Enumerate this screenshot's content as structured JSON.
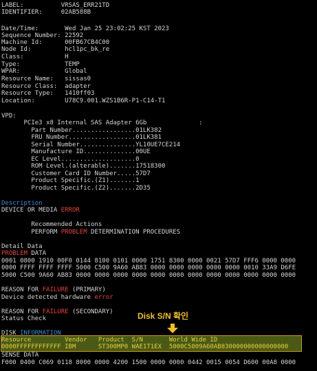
{
  "header": {
    "label_line": "LABEL:          VRSAS_ERR21TD",
    "identifier_line": "IDENTIFIER:     02AB588B"
  },
  "details": [
    "Date/Time:       Wed Jan 25 23:02:25 KST 2023",
    "Sequence Number: 22592",
    "Machine Id:      00FB67CB4C00",
    "Node Id:         hcl1pc_bk_re",
    "Class:           H",
    "Type:            TEMP",
    "WPAR:            Global",
    "Resource Name:   sissas0",
    "Resource Class:  adapter",
    "Resource Type:   1410ff03",
    "Location:        U78C9.001.WZS1B6R-P1-C14-T1"
  ],
  "vpd": {
    "heading": "VPD:",
    "adapter_line": "      PCIe3 x8 Internal SAS Adapter 6Gb              :",
    "fields": [
      "        Part Number.................01LK382",
      "        FRU Number..................01LK381",
      "        Serial Number...............YL10UE7CE214",
      "        Manufacture ID..............00UE",
      "        EC Level....................0",
      "        ROM Level.(alterable).......17518300",
      "        Customer Card ID Number.....57D7",
      "        Product Specific.(Z1).......1",
      "        Product Specific.(Z2).......2D35"
    ]
  },
  "description": {
    "heading": "Description",
    "line_prefix": "DEVICE OR MEDIA ",
    "line_error": "ERROR",
    "actions_heading": "        Recommended Actions",
    "action_prefix": "        PERFORM ",
    "action_problem": "PROBLEM",
    "action_suffix": " DETERMINATION PROCEDURES"
  },
  "detail_data": {
    "heading": "Detail Data",
    "problem_word": "PROBLEM",
    "problem_suffix": " DATA",
    "hex_lines": [
      "0001 0800 1910 00F0 0144 8100 0101 0000 1751 8300 0000 0021 57D7 FFF6 0000 0000",
      "0000 FFFF FFFF FFFF 5000 C500 9A60 AB83 0000 0000 0000 0000 0000 0010 33A9 D6FE",
      "5000 C500 9A60 AB83 0000 0000 0000 0000 0000 0000 0000 0000 0000 0000 0000 0000"
    ]
  },
  "reason_primary": {
    "prefix": "REASON FOR ",
    "failure": "FAILURE",
    "suffix": " (PRIMARY)",
    "detail_prefix": "Device detected hardware ",
    "detail_error": "error"
  },
  "reason_secondary": {
    "prefix": "REASON FOR ",
    "failure": "FAILURE",
    "suffix": " (SECONDARY)",
    "detail": "Status Check"
  },
  "disk_information": {
    "prefix": "DISK ",
    "heading": "INFORMATION",
    "table_header": "Resource         Vendor   Product  S/N       World Wide ID",
    "table_row": "0000FFFFFFFFFFFF IBM      ST300MP0 WAE1T1EX  5000C5009A60AB830000000000000000"
  },
  "sense_data": {
    "heading": "SENSE DATA",
    "line": "F000 0400 C069 0118 8000 0000 4200 1500 0000 0000 0442 0015 0054 D600 00A8 0000"
  },
  "annotation": {
    "label": "Disk S/N 확인",
    "icon": "down-arrow-icon"
  },
  "colors": {
    "background": "#000000",
    "text": "#d6d6d6",
    "keyword_red": "#e8453c",
    "heading_blue": "#3b8ee0",
    "annotation_yellow": "#f2c018",
    "highlight_fill": "#4a5a16",
    "highlight_border": "#c89a22",
    "highlight_text": "#e6cf3a"
  }
}
